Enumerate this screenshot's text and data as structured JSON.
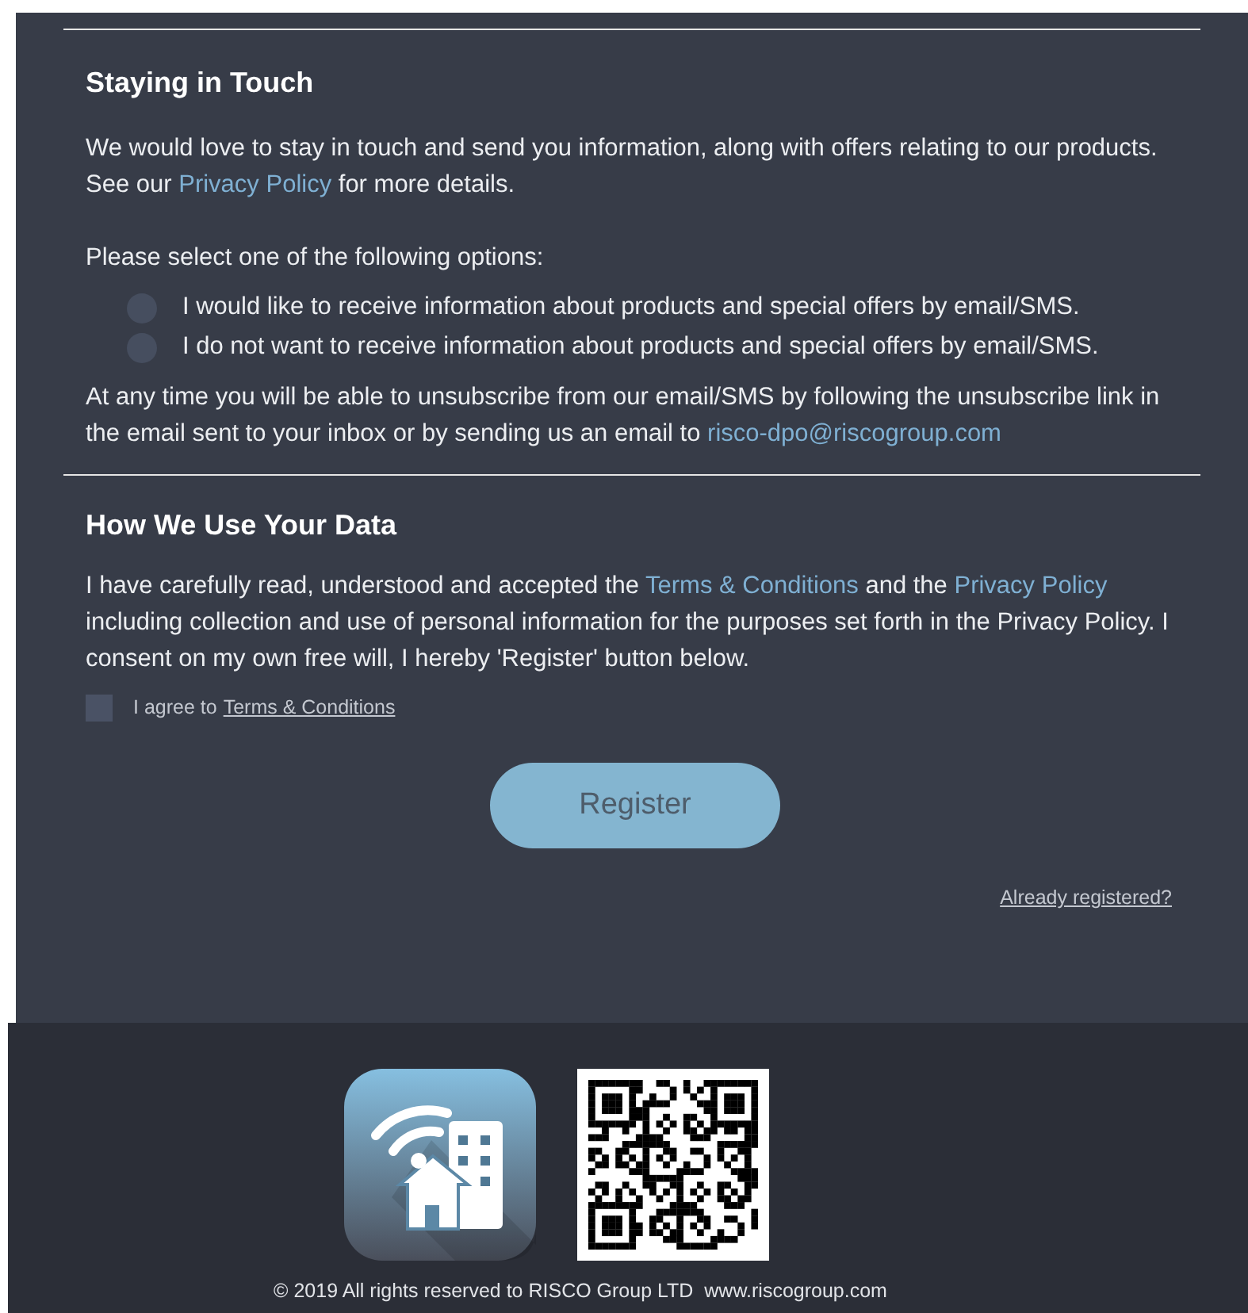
{
  "staying_in_touch": {
    "title": "Staying in Touch",
    "intro": [
      {
        "kind": "text",
        "text": "We would love to stay in touch and send you information, along with offers relating to our products. See our "
      },
      {
        "kind": "link",
        "text": "Privacy Policy"
      },
      {
        "kind": "text",
        "text": " for more details."
      }
    ],
    "prompt": "Please select one of the following options:",
    "options": [
      {
        "label": "I would like to receive information about products and special offers by email/SMS.",
        "selected": false
      },
      {
        "label": "I do not want to receive information about products and special offers by email/SMS.",
        "selected": false
      }
    ],
    "note": [
      {
        "kind": "text",
        "text": "At any time you will be able to unsubscribe from our email/SMS by following the unsubscribe link in the email sent to your inbox or by sending us an email to "
      },
      {
        "kind": "link",
        "text": "risco-dpo@riscogroup.com"
      }
    ]
  },
  "data_use": {
    "title": "How We Use Your Data",
    "consent": [
      {
        "kind": "text",
        "text": "I have carefully read, understood and accepted the "
      },
      {
        "kind": "link",
        "text": "Terms & Conditions"
      },
      {
        "kind": "text",
        "text": " and the "
      },
      {
        "kind": "link",
        "text": "Privacy Policy"
      },
      {
        "kind": "text",
        "text": " including collection and use of personal information for the purposes set forth in the Privacy Policy. I consent on my own free will, I hereby 'Register' button below."
      }
    ],
    "agree": {
      "label": "I agree to",
      "link": "Terms & Conditions",
      "checked": false
    },
    "register_button": "Register",
    "already_registered": "Already registered?"
  },
  "footer": {
    "copyright": "© 2019 All rights reserved to RISCO Group LTD  www.riscogroup.com"
  }
}
